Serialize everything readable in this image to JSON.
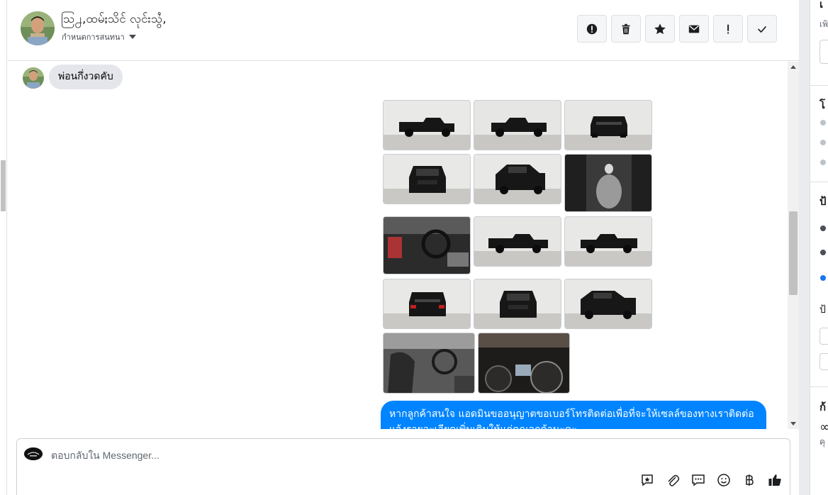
{
  "header": {
    "contact_name": "ဩ႕,ထမ်ႈသိင် လုင်းသွႆ,",
    "conversation_status": "กำหนดการสนทนา",
    "actions": [
      {
        "icon": "alert-circle-icon",
        "name": "mark-spam-button"
      },
      {
        "icon": "trash-icon",
        "name": "delete-button"
      },
      {
        "icon": "star-icon",
        "name": "star-button"
      },
      {
        "icon": "envelope-icon",
        "name": "mark-unread-button"
      },
      {
        "icon": "exclamation-icon",
        "name": "follow-up-button"
      },
      {
        "icon": "check-icon",
        "name": "mark-done-button"
      }
    ]
  },
  "messages": {
    "incoming_text": "พ่อนกึ่งวดคับ",
    "photo_count": 14,
    "outgoing_text": "หากลูกค้าสนใจ แอดมินขออนุญาตขอเบอร์โทรติดต่อเพื่อที่จะให้เซลล์ของทางเราติดต่อแจ้งรายละเอียดเพิ่มเติมให้แก่คุณลูกค้านะคะ"
  },
  "composer": {
    "placeholder": "ตอบกลับใน Messenger...",
    "tools": [
      "saved-reply-icon",
      "attachment-icon",
      "message-icon",
      "emoji-icon",
      "baht-icon",
      "thumbs-up-icon"
    ]
  },
  "right_panel": {
    "fragments": [
      "เ",
      "เพิ",
      "โ",
      "ป้",
      "ป้",
      "ก้",
      "∞",
      "คุ"
    ]
  },
  "colors": {
    "accent": "#0084ff",
    "bubble_in": "#e4e6eb",
    "border": "#dddfe2"
  }
}
